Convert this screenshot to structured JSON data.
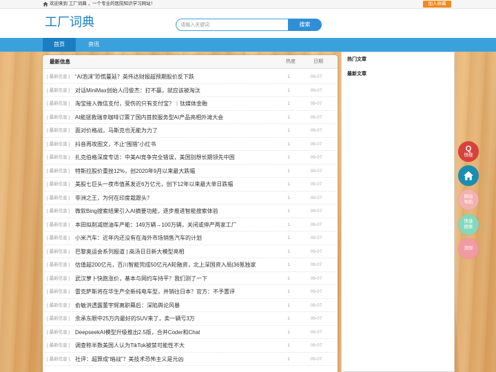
{
  "theme": {
    "accent": "#3aa1dd",
    "nav_active": "#1c7ec2",
    "logo": "#1a7fc4",
    "favorite": "#f08a1c",
    "search_button": "#2f8fd6"
  },
  "topbar": {
    "icon": "home-icon",
    "welcome": "欢迎来到 工厂词典 ，一个专业的医院知识学习网站！",
    "favorite_button": "加入收藏"
  },
  "header": {
    "logo": "工厂词典",
    "search": {
      "placeholder": "请输入关键词",
      "button": "搜索"
    }
  },
  "nav": {
    "items": [
      {
        "label": "首页",
        "active": true
      },
      {
        "label": "资讯",
        "active": false
      }
    ]
  },
  "list": {
    "heading": "最新信息",
    "col_heat": "热度",
    "col_date": "日期",
    "row_tag": "[ 最新信息 ]",
    "rows": [
      {
        "title": "“AI泡沫”恐慌蔓延？英伟达财报超预期股价反下跌",
        "heat": "1",
        "date": "09-07"
      },
      {
        "title": "对话MiniMax创始人闫俊杰：打不赢，就应该被淘汰",
        "heat": "1",
        "date": "09-07"
      },
      {
        "title": "淘宝接入微信支付，受伤的只有支付宝？｜钛媒体金融",
        "heat": "1",
        "date": "09-07"
      },
      {
        "title": "AI能拯救瑞幸咖啡订票了国内首款服务型AI产品亮相外滩大会",
        "heat": "1",
        "date": "09-07"
      },
      {
        "title": "面对价格战，马斯克也无能为力了",
        "heat": "1",
        "date": "09-07"
      },
      {
        "title": "抖音再攻图文，不止“围猎”小红书",
        "heat": "1",
        "date": "09-07"
      },
      {
        "title": "扎克伯格深度专访：中美AI竞争完全错误，美国别想长期领先中国",
        "heat": "1",
        "date": "09-07"
      },
      {
        "title": "特斯拉股价重挫12%，创2020年9月以来最大跌幅",
        "heat": "1",
        "date": "09-07"
      },
      {
        "title": "美股七巨头一夜市值蒸发近6万亿元，创下12年以来最大单日跌幅",
        "heat": "1",
        "date": "09-07"
      },
      {
        "title": "非洲之王，为何在印度栽跟头？",
        "heat": "1",
        "date": "09-07"
      },
      {
        "title": "微软Bing搜索结果引入AI摘要功能，逐步推进智能搜索体验",
        "heat": "1",
        "date": "09-07"
      },
      {
        "title": "本田拟削减燃油车产能：149万辆→100万辆，关闭或停产两家工厂",
        "heat": "1",
        "date": "09-07"
      },
      {
        "title": "小米汽车：近年内还没有在海外市场销售汽车的计划",
        "heat": "1",
        "date": "09-07"
      },
      {
        "title": "巴黎奥运会系列报道 | 商汤日日新大模型亮相",
        "heat": "1",
        "date": "09-07"
      },
      {
        "title": "估值超200亿元，百川智能完成50亿元A轮融资，北上深国资入局|36氪独家",
        "heat": "1",
        "date": "09-07"
      },
      {
        "title": "武汉萝卜快跑涨价，基本与网约车持平？我们测了一下",
        "heat": "1",
        "date": "09-07"
      },
      {
        "title": "雷克萨斯将在华生产全新纯电车型，并销往日本？官方：不予置评",
        "heat": "1",
        "date": "09-07"
      },
      {
        "title": "俞敏洪透露董宇辉离职幕后：深陷舆论风暴",
        "heat": "1",
        "date": "09-07"
      },
      {
        "title": "余承东眼中25万内最好的SUV来了，卖一辆亏3万",
        "heat": "1",
        "date": "09-07"
      },
      {
        "title": "DeepseekAI模型升级推出2.5版，合并Coder和Chat",
        "heat": "1",
        "date": "09-07"
      },
      {
        "title": "调查称半数美国人认为TikTok被禁可能性不大",
        "heat": "1",
        "date": "09-07"
      },
      {
        "title": "社评：超算成“暗战”？美技术恐怖主义是元凶",
        "heat": "1",
        "date": "09-07"
      }
    ]
  },
  "sidebar": {
    "hot_title": "热门文章",
    "latest_title": "最新文章"
  },
  "float": {
    "items": [
      {
        "glyph": "Q",
        "label": "快搜",
        "color": "#d8423c"
      },
      {
        "icon": "home-icon",
        "color": "#1a8db3"
      },
      {
        "label": "网站导航",
        "color": "#f5b0b0"
      },
      {
        "label": "快速搜索",
        "color": "#86d8bd"
      },
      {
        "label": "顶部",
        "color": "#f29aa3"
      }
    ]
  }
}
